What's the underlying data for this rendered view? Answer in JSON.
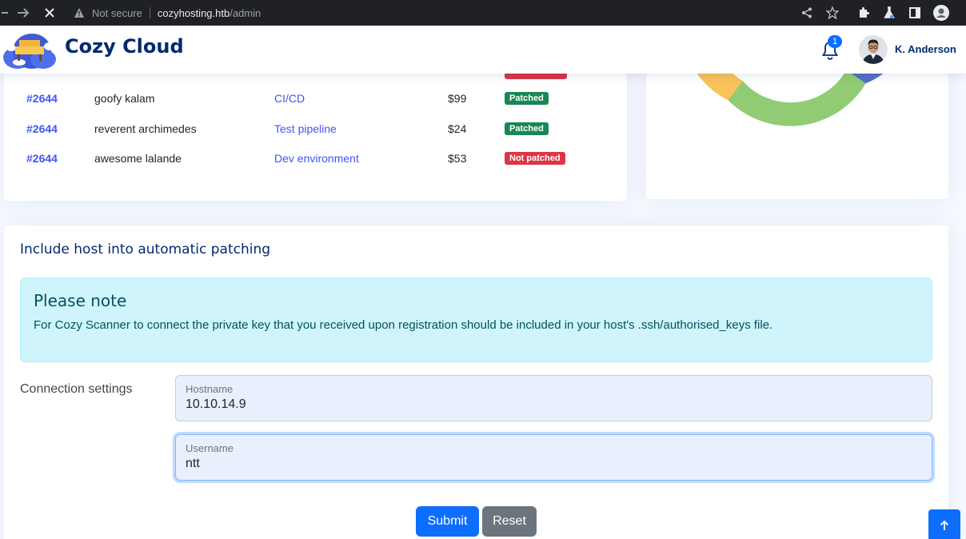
{
  "browser": {
    "not_secure": "Not secure",
    "url_host": "cozyhosting.htb",
    "url_path": "/admin"
  },
  "header": {
    "brand": "Cozy Cloud",
    "notification_count": "1",
    "user_name": "K. Anderson"
  },
  "orders": {
    "rows": [
      {
        "id": "#2644",
        "name": "goofy kalam",
        "product": "CI/CD",
        "price": "$99",
        "status": "Patched",
        "status_type": "success"
      },
      {
        "id": "#2644",
        "name": "reverent archimedes",
        "product": "Test pipeline",
        "price": "$24",
        "status": "Patched",
        "status_type": "success"
      },
      {
        "id": "#2644",
        "name": "awesome lalande",
        "product": "Dev environment",
        "price": "$53",
        "status": "Not patched",
        "status_type": "danger"
      }
    ]
  },
  "chart": {
    "type": "doughnut",
    "colors": {
      "yellow": "#f8c358",
      "green": "#91cc75",
      "blue": "#5470c6"
    }
  },
  "form": {
    "title": "Include host into automatic patching",
    "alert_title": "Please note",
    "alert_text": "For Cozy Scanner to connect the private key that you received upon registration should be included in your host's .ssh/authorised_keys file.",
    "connection_label": "Connection settings",
    "hostname_label": "Hostname",
    "hostname_value": "10.10.14.9",
    "username_label": "Username",
    "username_value": "ntt",
    "submit_label": "Submit",
    "reset_label": "Reset"
  },
  "colors": {
    "brand": "#012970",
    "link": "#4154f1",
    "primary": "#0d6efd",
    "success": "#198754",
    "danger": "#dc3545"
  }
}
